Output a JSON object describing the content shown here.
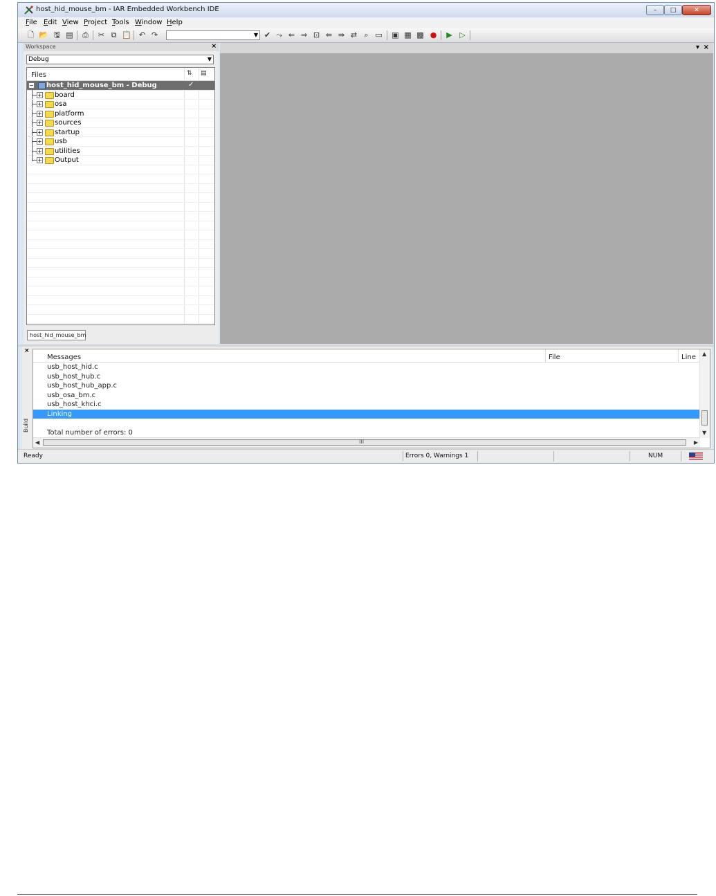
{
  "window": {
    "title": "host_hid_mouse_bm - IAR Embedded Workbench IDE",
    "controls": {
      "minimize": "–",
      "maximize": "□",
      "close": "✕"
    }
  },
  "menu": [
    {
      "label": "File",
      "accel": "F",
      "rest": "ile"
    },
    {
      "label": "Edit",
      "accel": "E",
      "rest": "dit"
    },
    {
      "label": "View",
      "accel": "V",
      "rest": "iew"
    },
    {
      "label": "Project",
      "accel": "P",
      "rest": "roject"
    },
    {
      "label": "Tools",
      "accel": "T",
      "rest": "ools"
    },
    {
      "label": "Window",
      "accel": "W",
      "rest": "indow"
    },
    {
      "label": "Help",
      "accel": "H",
      "rest": "elp"
    }
  ],
  "toolbar": {
    "icons": [
      "new-file",
      "open",
      "save",
      "save-all",
      "print",
      "cut",
      "copy",
      "paste",
      "undo",
      "redo",
      "find-combo",
      "toggle-bookmark",
      "next-bookmark",
      "navigate-back",
      "navigate-forward",
      "go-to",
      "find-prev",
      "find-next",
      "replace",
      "find-in-files",
      "compile",
      "make",
      "stop-build",
      "toggle-breakpoint",
      "download-and-debug",
      "debug-without-download"
    ],
    "search_value": ""
  },
  "workspace": {
    "title": "Workspace",
    "close": "×",
    "config": "Debug",
    "files_header": "Files",
    "root": {
      "label": "host_hid_mouse_bm - Debug",
      "check": "✓"
    },
    "folders": [
      "board",
      "osa",
      "platform",
      "sources",
      "startup",
      "usb",
      "utilities",
      "Output"
    ],
    "tab": "host_hid_mouse_bm"
  },
  "editor": {
    "dropdown": "▾",
    "close": "×"
  },
  "build": {
    "close": "×",
    "side_label": "Build",
    "headers": {
      "messages": "Messages",
      "file": "File",
      "line": "Line"
    },
    "messages": [
      "usb_host_hid.c",
      "usb_host_hub.c",
      "usb_host_hub_app.c",
      "usb_osa_bm.c",
      "usb_host_khci.c",
      "Linking",
      "",
      "Total number of errors: 0"
    ],
    "selected_index": 5,
    "hscroll_grip": "III"
  },
  "status": {
    "ready": "Ready",
    "errors": "Errors 0, Warnings 1",
    "num": "NUM",
    "locale_icon": "us-flag-icon"
  },
  "colors": {
    "selection": "#3399ff",
    "editor_bg": "#ababab",
    "root_row": "#6e6e6e"
  }
}
